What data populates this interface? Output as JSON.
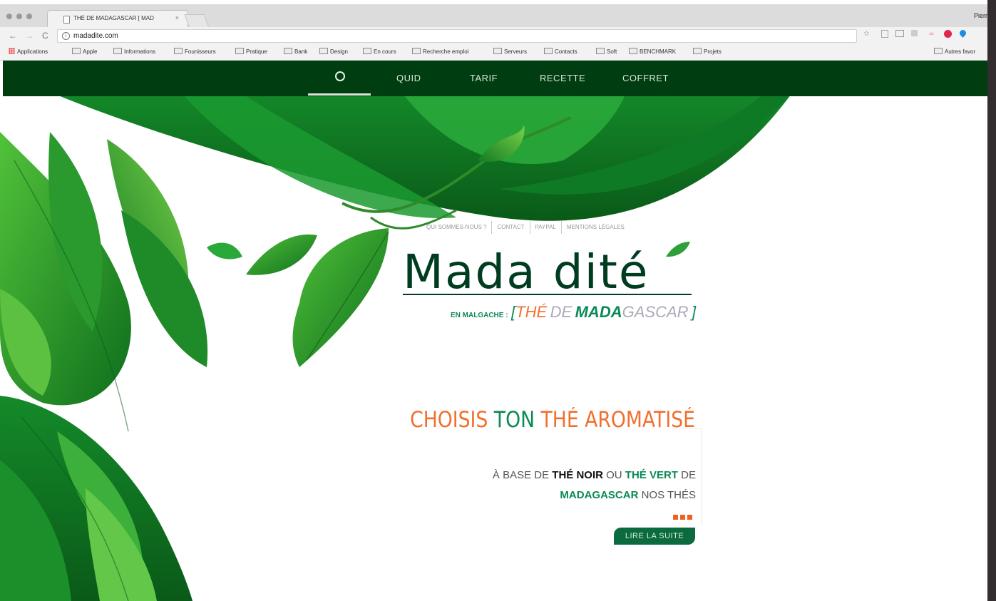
{
  "browser": {
    "tab_title": "THÉ DE MADAGASCAR [ MAD",
    "tab_close": "×",
    "profile_name": "Pierr",
    "url": "madadite.com",
    "nav": {
      "back": "←",
      "forward": "→",
      "reload": "C"
    },
    "bookmarks": [
      "Applications",
      "Apple",
      "Informations",
      "Founisseurs",
      "Pratique",
      "Bank",
      "Design",
      "En cours",
      "Recherche emploi",
      "Serveurs",
      "Contacts",
      "Soft",
      "BENCHMARK",
      "Projets"
    ],
    "other_bookmarks": "Autres favor"
  },
  "site": {
    "menu": [
      "QUID",
      "TARIF",
      "RECETTE",
      "COFFRET"
    ],
    "sublinks": [
      "QUI SOMMES-NOUS ?",
      "CONTACT",
      "PAYPAL",
      "MENTIONS LÉGALES"
    ],
    "logo": "Mada dité",
    "tagline": {
      "prefix": "EN MALGACHE :",
      "open": "[",
      "the": "THÉ",
      "de": "DE",
      "mada": "MADA",
      "gascar": "GASCAR",
      "close": "]"
    },
    "headline": {
      "part1": "CHOISIS ",
      "part2": "TON ",
      "part3": "THÉ AROMATISÉ"
    },
    "description": {
      "l1a": "À BASE DE ",
      "l1b": "THÉ NOIR",
      "l1c": " OU ",
      "l1d": "THÉ VERT",
      "l1e": " DE",
      "l2a": "MADAGASCAR",
      "l2b": " NOS THÉS"
    },
    "read_more": "LIRE LA SUITE"
  },
  "colors": {
    "nav_bg": "#003d11",
    "orange": "#f07030",
    "teal": "#0a8a55",
    "button": "#0c6b3e"
  }
}
